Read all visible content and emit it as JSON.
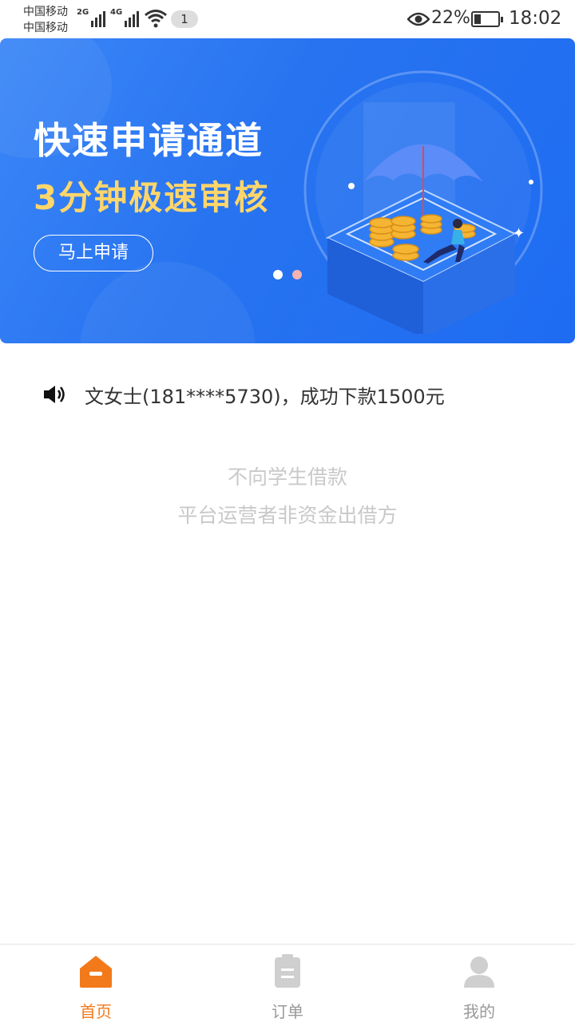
{
  "status_bar": {
    "carrier_1": "中国移动",
    "carrier_2": "中国移动",
    "network_1": "2G",
    "network_2": "4G",
    "notification_count": "1",
    "battery_percent": "22%",
    "time": "18:02"
  },
  "banner": {
    "title": "快速申请通道",
    "subtitle": "3分钟极速审核",
    "button_label": "马上申请",
    "slide_count": 2,
    "active_slide": 1,
    "colors": {
      "background": "#2773f0",
      "subtitle": "#ffd66b",
      "active_dot": "#ffffff",
      "inactive_dot": "#f4b3b3"
    }
  },
  "ticker": {
    "icon": "speaker-icon",
    "text": "文女士(181****5730)，成功下款1500元"
  },
  "notices": {
    "line_1": "不向学生借款",
    "line_2": "平台运营者非资金出借方"
  },
  "bottom_nav": {
    "active_color": "#f27a1a",
    "inactive_color": "#999999",
    "tabs": [
      {
        "label": "首页",
        "icon": "home-icon",
        "active": true
      },
      {
        "label": "订单",
        "icon": "clipboard-icon",
        "active": false
      },
      {
        "label": "我的",
        "icon": "user-icon",
        "active": false
      }
    ]
  }
}
